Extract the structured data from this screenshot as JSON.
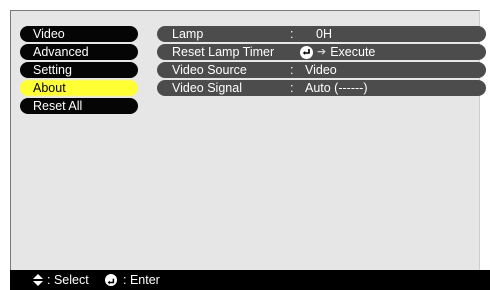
{
  "menu": {
    "items": [
      {
        "label": "Video"
      },
      {
        "label": "Advanced"
      },
      {
        "label": "Setting"
      },
      {
        "label": "About",
        "selected": true
      },
      {
        "label": "Reset All"
      }
    ]
  },
  "detail": {
    "rows": [
      {
        "label": "Lamp",
        "separator": ":",
        "value": "0H"
      },
      {
        "label": "Reset Lamp Timer",
        "value": "Execute",
        "icon": "enter-icon",
        "arrow": "➔"
      },
      {
        "label": "Video Source",
        "separator": ":",
        "value": "Video"
      },
      {
        "label": "Video Signal",
        "separator": ":",
        "value": "Auto (------)"
      }
    ]
  },
  "footer": {
    "select_sep": ":",
    "select_label": "Select",
    "enter_sep": ":",
    "enter_label": "Enter",
    "icons": [
      "up-down-icon",
      "enter-icon"
    ]
  },
  "colors": {
    "menu_bg": "#050505",
    "menu_selected_bg": "#ffff33",
    "row_bg": "#4c4c4c",
    "panel_bg": "#e6e6e6",
    "footer_bg": "#000000"
  }
}
